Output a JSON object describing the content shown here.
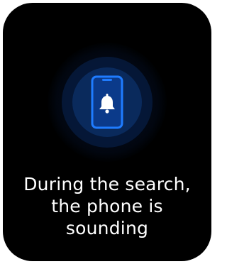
{
  "screen": {
    "icon": "phone-ringing-icon",
    "accent_color": "#1f7cff",
    "message_lines": [
      "During the search,",
      "the phone is",
      "sounding"
    ]
  }
}
